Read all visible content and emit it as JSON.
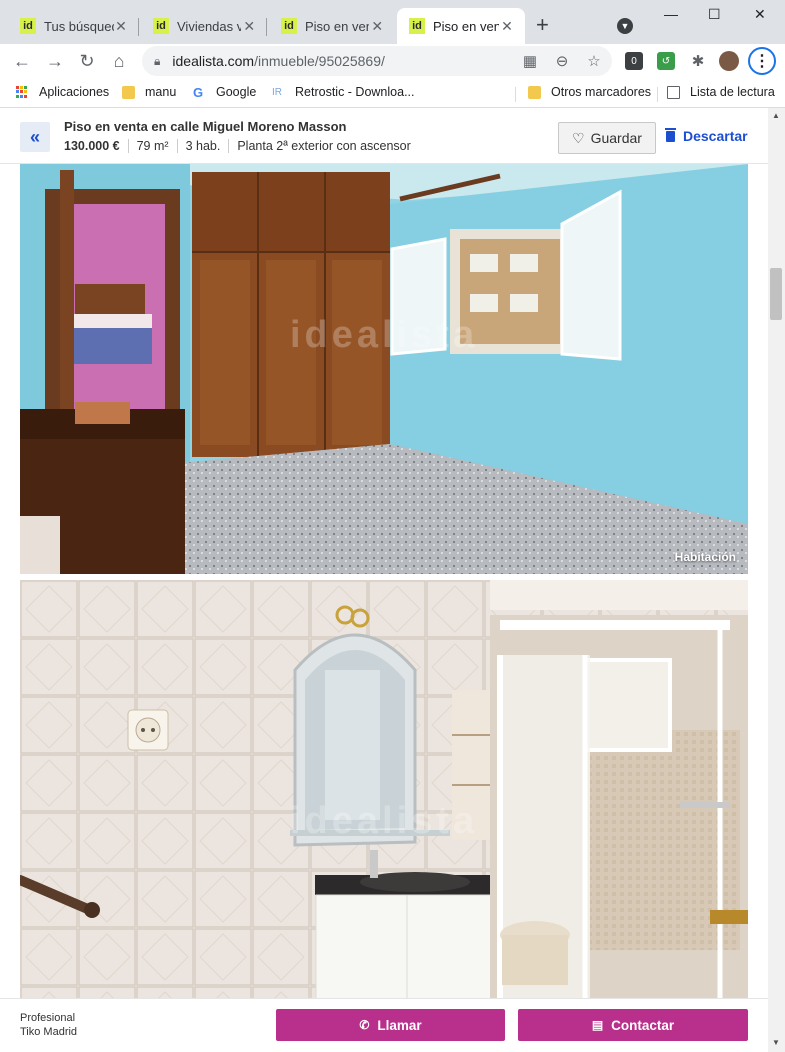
{
  "browser": {
    "tabs": [
      {
        "favicon": "id",
        "title": "Tus búsquedas"
      },
      {
        "favicon": "id",
        "title": "Viviendas ve"
      },
      {
        "favicon": "id",
        "title": "Piso en vent"
      },
      {
        "favicon": "id",
        "title": "Piso en vent"
      }
    ],
    "window_controls": {
      "minimize": "—",
      "maximize": "☐",
      "close": "✕"
    },
    "url": {
      "host": "idealista.com",
      "path": "/inmueble/95025869/"
    },
    "bookmarks": [
      "Aplicaciones",
      "manu",
      "Google",
      "Retrostic - Downloa...",
      "Otros marcadores",
      "Lista de lectura"
    ]
  },
  "header": {
    "title": "Piso en venta en calle Miguel Moreno Masson",
    "price": "130.000 €",
    "area": "79 m²",
    "rooms": "3 hab.",
    "floor": "Planta 2ª exterior con ascensor",
    "save_label": "Guardar",
    "discard_label": "Descartar"
  },
  "photos": [
    {
      "caption": "Habitación",
      "watermark": "idealista"
    },
    {
      "caption": "",
      "watermark": "idealista"
    }
  ],
  "contact": {
    "agent_type": "Profesional",
    "agent_name": "Tiko Madrid",
    "call_label": "Llamar",
    "contact_label": "Contactar"
  },
  "colors": {
    "brand_magenta": "#b8308b",
    "link_blue": "#1c4fd0",
    "favicon_lime": "#d8f04a"
  }
}
